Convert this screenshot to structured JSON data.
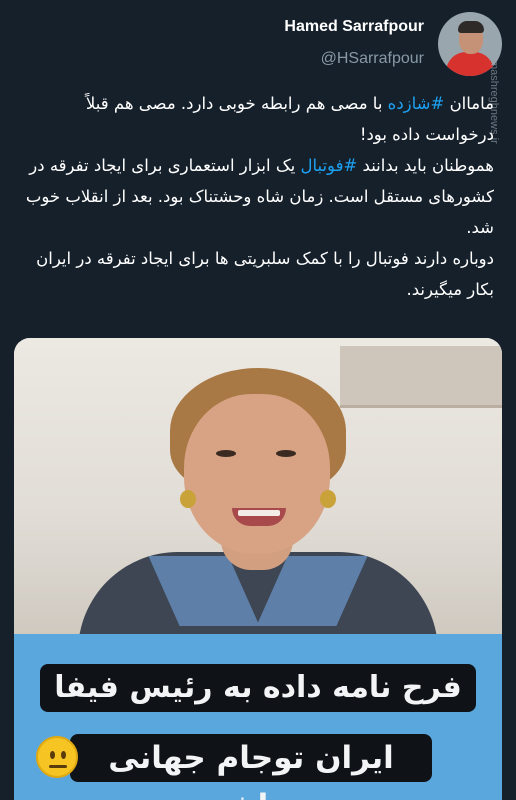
{
  "tweet": {
    "author": {
      "display_name": "Hamed Sarrafpour",
      "handle": "@HSarrafpour",
      "avatar_icon": "user-avatar"
    },
    "side_watermark": "mashreghnews.ir",
    "body_lines": {
      "p1_pre": "",
      "p1_tag1": "#شازده",
      "p1_mid": "ماماان",
      "p1_rest": " با مصی هم رابطه خوبی دارد. مصی هم قبلاً درخواست داده بود!",
      "p2_pre": "هموطنان باید بدانند ",
      "p2_tag": "#فوتبال",
      "p2_rest": " یک ابزار استعماری برای ایجاد تفرقه در کشورهای مستقل است. زمان شاه وحشتناک بود. بعد از انقلاب خوب شد.",
      "p3": "دوباره دارند فوتبال را با کمک سلبریتی ها برای ایجاد تفرقه در ایران بکار میگیرند."
    },
    "hashtag_color": "#1da1f2",
    "media": {
      "caption_line1": "فرح نامه داده به رئیس فیفا",
      "caption_line2": "ایران توجام جهانی نباشه",
      "emoji_icon": "neutral-face-emoji",
      "banner_color": "#5aa7de"
    }
  }
}
